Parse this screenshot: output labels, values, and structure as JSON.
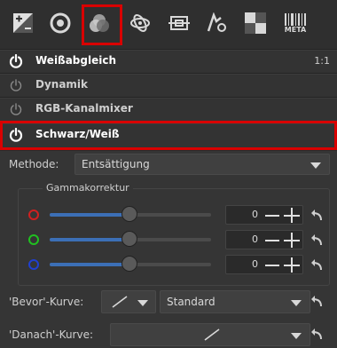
{
  "toolbar": {
    "meta_label": "META",
    "selected_tab": "color-tab"
  },
  "sections": [
    {
      "label": "Weißabgleich",
      "enabled": true,
      "badge": "1:1"
    },
    {
      "label": "Dynamik",
      "enabled": false
    },
    {
      "label": "RGB-Kanalmixer",
      "enabled": false
    },
    {
      "label": "Schwarz/Weiß",
      "enabled": true,
      "highlighted": true
    }
  ],
  "bw": {
    "method_label": "Methode:",
    "method_value": "Entsättigung",
    "gamma_title": "Gammakorrektur",
    "channels": [
      {
        "color": "#d02020",
        "value": "0",
        "level": 0.5
      },
      {
        "color": "#20c020",
        "value": "0",
        "level": 0.5
      },
      {
        "color": "#2040d0",
        "value": "0",
        "level": 0.5
      }
    ],
    "before_label": "'Bevor'-Kurve:",
    "before_value": "Standard",
    "after_label": "'Danach'-Kurve:"
  },
  "colors": {
    "highlight": "#d90000",
    "accent": "#3c6fb6"
  }
}
